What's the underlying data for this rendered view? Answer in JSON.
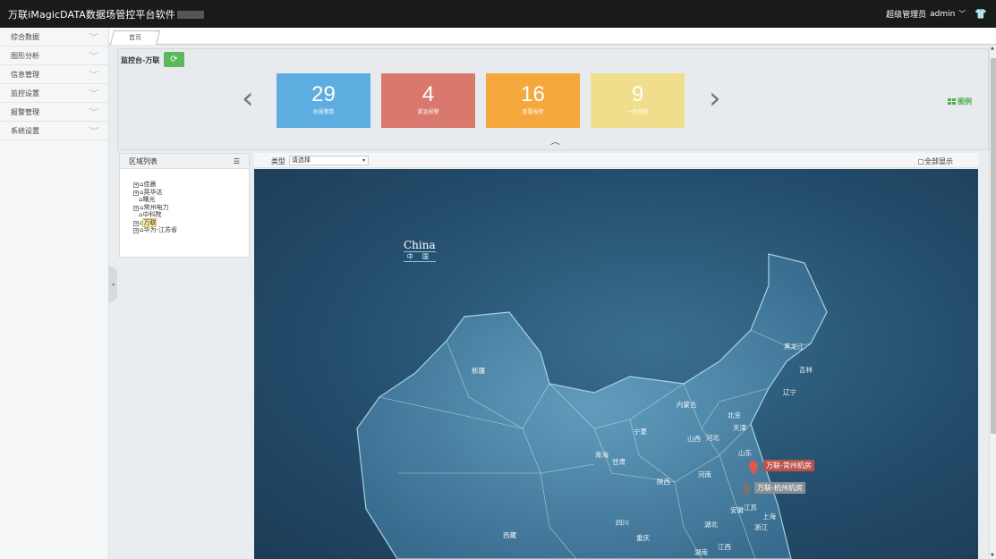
{
  "app": {
    "title": "万联iMagicDATA数据场管控平台软件",
    "user_role": "超级管理员",
    "username": "admin"
  },
  "sidebar": {
    "items": [
      {
        "label": "综合数据"
      },
      {
        "label": "图形分析"
      },
      {
        "label": "信息管理"
      },
      {
        "label": "监控设置"
      },
      {
        "label": "报警管理"
      },
      {
        "label": "系统设置"
      }
    ]
  },
  "tabs": [
    {
      "label": "首页"
    }
  ],
  "monitor": {
    "title": "监控台-万联",
    "tiles": [
      {
        "value": "29",
        "label": "总报警数",
        "color": "#5dade0"
      },
      {
        "value": "4",
        "label": "紧急报警",
        "color": "#d9786c"
      },
      {
        "value": "16",
        "label": "重要报警",
        "color": "#f5a83c"
      },
      {
        "value": "9",
        "label": "一般报警",
        "color": "#f0de8c"
      }
    ],
    "legend_label": "图例"
  },
  "region": {
    "header": "区域列表",
    "tree": [
      {
        "label": "佳晨"
      },
      {
        "label": "英华达"
      },
      {
        "label": "曙光"
      },
      {
        "label": "常州电力"
      },
      {
        "label": "中科院"
      },
      {
        "label": "万联"
      },
      {
        "label": "华为-江苏省"
      }
    ]
  },
  "filter": {
    "type_label": "类型",
    "type_value": "请选择",
    "show_all_label": "全部显示"
  },
  "map": {
    "title_en": "China",
    "title_zh": "中 国",
    "provinces": [
      "新疆",
      "黑龙江",
      "吉林",
      "辽宁",
      "内蒙古",
      "北京",
      "天津",
      "河北",
      "山西",
      "山东",
      "宁夏",
      "青海",
      "甘肃",
      "陕西",
      "河南",
      "江苏",
      "安徽",
      "上海",
      "浙江",
      "湖北",
      "四川",
      "重庆",
      "西藏",
      "江西",
      "湖南"
    ],
    "markers": [
      {
        "label": "万联-常州机房",
        "color": "#e0574d"
      },
      {
        "label": "万联-杭州机房",
        "color": "#8a8f95"
      }
    ]
  }
}
